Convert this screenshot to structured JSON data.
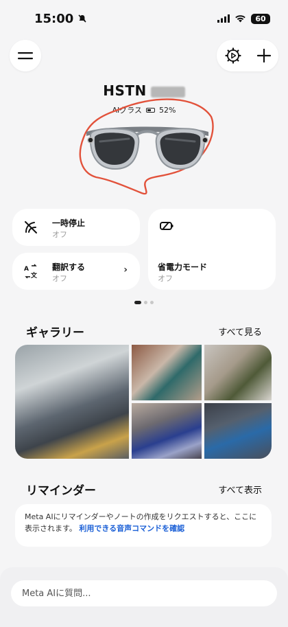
{
  "status_bar": {
    "time": "15:00",
    "battery": "60"
  },
  "device": {
    "name": "HSTN",
    "type_label": "AIグラス",
    "battery": "52%"
  },
  "cards": {
    "pause": {
      "title": "一時停止",
      "status": "オフ"
    },
    "translate": {
      "title": "翻訳する",
      "status": "オフ"
    },
    "power_saving": {
      "title": "省電力モード",
      "status": "オフ"
    }
  },
  "gallery": {
    "title": "ギャラリー",
    "see_all": "すべて見る"
  },
  "reminders": {
    "title": "リマインダー",
    "see_all": "すべて表示",
    "message": "Meta AIにリマインダーやノートの作成をリクエストすると、ここに表示されます。",
    "link": "利用できる音声コマンドを確認"
  },
  "ask": {
    "placeholder": "Meta AIに質問..."
  },
  "colors": {
    "background": "#f5f5f6",
    "card": "#ffffff",
    "link_blue": "#1a5fd6",
    "annotation_red": "#e2523b"
  },
  "icons": {
    "menu": "hamburger-icon",
    "settings": "gear-play-icon",
    "add": "plus-icon",
    "pause": "pause-slash-icon",
    "translate": "translate-icon",
    "power": "battery-saver-icon"
  }
}
